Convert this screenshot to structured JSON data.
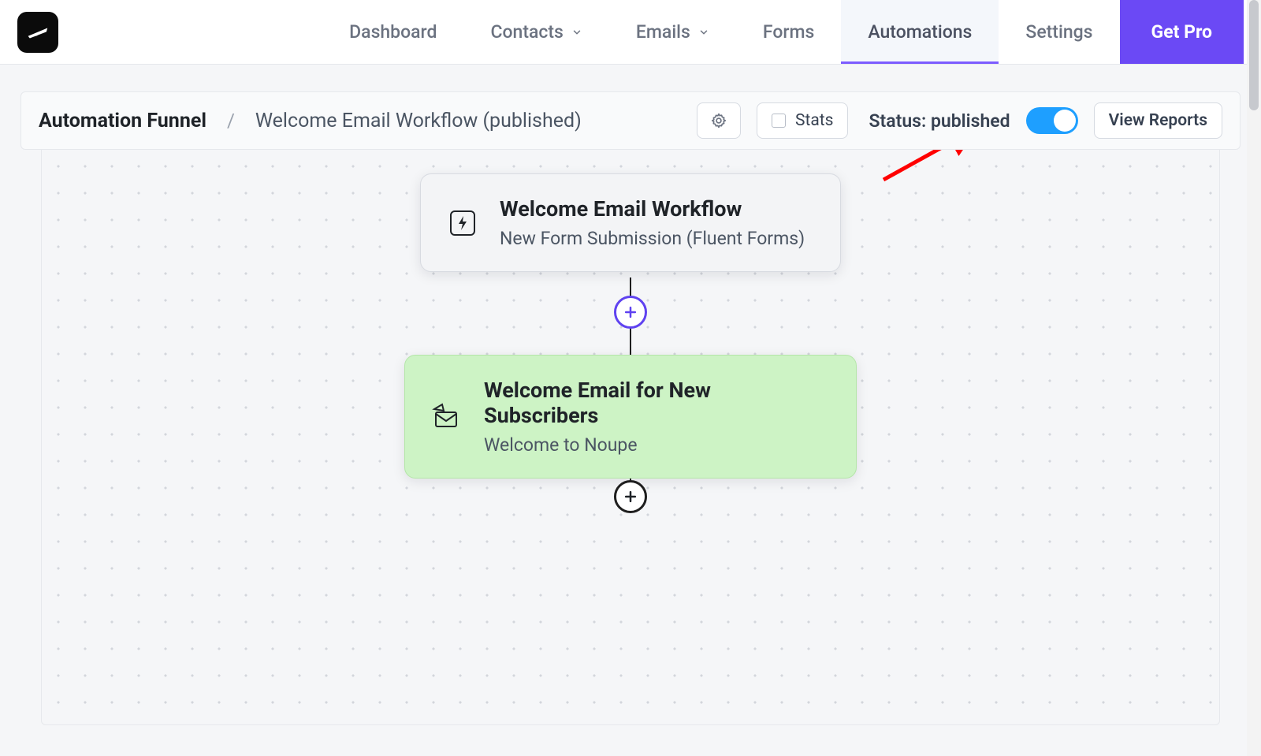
{
  "colors": {
    "accent_purple": "#6b49f5",
    "toggle_blue": "#1e9fff",
    "action_node_bg": "#cdf3c5"
  },
  "nav": {
    "items": [
      {
        "label": "Dashboard",
        "active": false
      },
      {
        "label": "Contacts",
        "active": false
      },
      {
        "label": "Emails",
        "active": false
      },
      {
        "label": "Forms",
        "active": false
      },
      {
        "label": "Automations",
        "active": true
      },
      {
        "label": "Settings",
        "active": false
      }
    ],
    "cta_label": "Get Pro"
  },
  "subheader": {
    "breadcrumb_root": "Automation Funnel",
    "breadcrumb_sep": "/",
    "breadcrumb_title": "Welcome Email Workflow (published)",
    "stats_label": "Stats",
    "status_label": "Status: published",
    "status_on": true,
    "view_reports_label": "View Reports"
  },
  "workflow": {
    "trigger": {
      "title": "Welcome Email Workflow",
      "subtitle": "New Form Submission (Fluent Forms)"
    },
    "action": {
      "title": "Welcome Email for New Subscribers",
      "subtitle": "Welcome to Noupe"
    }
  }
}
